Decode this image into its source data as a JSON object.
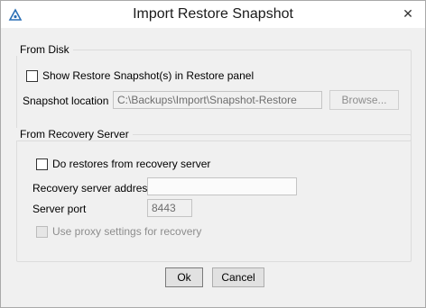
{
  "window": {
    "title": "Import Restore Snapshot",
    "close_glyph": "✕",
    "app_icon": "app-logo-icon"
  },
  "from_disk": {
    "group_title": "From Disk",
    "show_checkbox_label": "Show Restore Snapshot(s) in Restore panel",
    "show_checkbox_checked": false,
    "location_label": "Snapshot location",
    "location_value": "C:\\Backups\\Import\\Snapshot-Restore",
    "browse_label": "Browse..."
  },
  "from_server": {
    "group_title": "From Recovery Server",
    "restore_checkbox_label": "Do restores from recovery server",
    "restore_checkbox_checked": false,
    "address_label": "Recovery server address",
    "address_value": "",
    "port_label": "Server port",
    "port_value": "8443",
    "proxy_checkbox_label": "Use proxy settings for recovery",
    "proxy_checkbox_checked": false
  },
  "footer": {
    "ok_label": "Ok",
    "cancel_label": "Cancel"
  }
}
